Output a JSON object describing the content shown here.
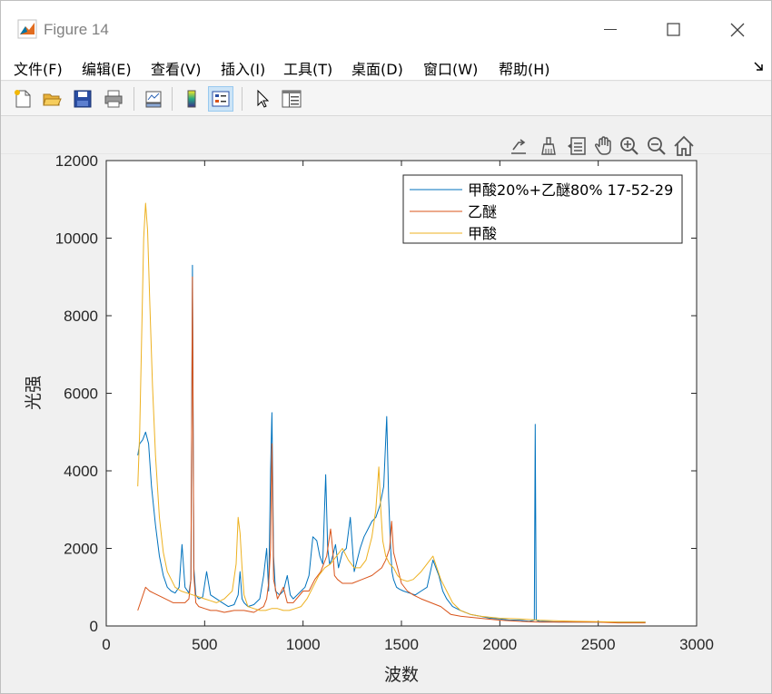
{
  "window": {
    "title": "Figure 14"
  },
  "menu": [
    {
      "label": "文件(F)"
    },
    {
      "label": "编辑(E)"
    },
    {
      "label": "查看(V)"
    },
    {
      "label": "插入(I)"
    },
    {
      "label": "工具(T)"
    },
    {
      "label": "桌面(D)"
    },
    {
      "label": "窗口(W)"
    },
    {
      "label": "帮助(H)"
    }
  ],
  "toolbar": [
    "new-figure",
    "open-file",
    "save",
    "print",
    "link-plot",
    "colorbar",
    "legend",
    "pointer",
    "property-inspector"
  ],
  "axes_toolbar": [
    "export",
    "brush",
    "data-tips",
    "pan",
    "zoom-in",
    "zoom-out",
    "home"
  ],
  "colors": {
    "series1": "#0072BD",
    "series2": "#D95319",
    "series3": "#EDB120"
  },
  "chart_data": {
    "type": "line",
    "xlabel": "波数",
    "ylabel": "光强",
    "xlim": [
      0,
      3000
    ],
    "ylim": [
      0,
      12000
    ],
    "xticks": [
      "0",
      "500",
      "1000",
      "1500",
      "2000",
      "2500",
      "3000"
    ],
    "yticks": [
      "0",
      "2000",
      "4000",
      "6000",
      "8000",
      "10000",
      "12000"
    ],
    "legend_position": "top-right",
    "grid": false,
    "series": [
      {
        "name": "甲酸20%+乙醚80% 17-52-29",
        "color": "#0072BD",
        "x": [
          160,
          170,
          185,
          200,
          215,
          230,
          250,
          270,
          290,
          310,
          330,
          350,
          370,
          385,
          400,
          420,
          430,
          438,
          445,
          455,
          470,
          490,
          510,
          530,
          560,
          590,
          620,
          650,
          670,
          680,
          690,
          700,
          720,
          750,
          780,
          800,
          815,
          825,
          835,
          842,
          850,
          860,
          880,
          900,
          920,
          935,
          950,
          970,
          990,
          1010,
          1030,
          1050,
          1070,
          1085,
          1100,
          1115,
          1125,
          1135,
          1145,
          1155,
          1165,
          1180,
          1200,
          1220,
          1240,
          1260,
          1275,
          1290,
          1310,
          1330,
          1350,
          1370,
          1390,
          1410,
          1425,
          1435,
          1445,
          1452,
          1460,
          1475,
          1490,
          1510,
          1540,
          1570,
          1600,
          1630,
          1660,
          1690,
          1710,
          1730,
          1760,
          1800,
          1850,
          1900,
          1950,
          2000,
          2050,
          2100,
          2150,
          2175,
          2180,
          2185,
          2200,
          2250,
          2300,
          2350,
          2400,
          2450,
          2500,
          2550,
          2600,
          2650,
          2700,
          2740
        ],
        "values": [
          4400,
          4700,
          4800,
          5000,
          4700,
          3600,
          2600,
          1800,
          1300,
          1000,
          900,
          850,
          1000,
          2100,
          1000,
          850,
          1200,
          9300,
          1500,
          800,
          700,
          750,
          1400,
          800,
          700,
          600,
          500,
          550,
          800,
          1400,
          700,
          600,
          500,
          550,
          700,
          1300,
          2000,
          900,
          4000,
          5500,
          1800,
          900,
          800,
          900,
          1300,
          800,
          700,
          800,
          900,
          1000,
          1300,
          2300,
          2200,
          1800,
          1600,
          3900,
          2000,
          1600,
          1700,
          1900,
          2100,
          1500,
          1900,
          2000,
          2800,
          1400,
          1700,
          2000,
          2300,
          2500,
          2700,
          2800,
          3100,
          3600,
          5400,
          3300,
          2000,
          1400,
          1200,
          1000,
          950,
          900,
          850,
          800,
          900,
          1000,
          1700,
          1300,
          900,
          700,
          500,
          400,
          300,
          250,
          200,
          180,
          150,
          150,
          120,
          150,
          5200,
          150,
          120,
          110,
          100,
          100,
          100,
          100,
          100,
          100,
          100,
          100,
          100,
          100
        ]
      },
      {
        "name": "乙醚",
        "color": "#D95319",
        "x": [
          160,
          180,
          200,
          220,
          240,
          260,
          280,
          300,
          320,
          340,
          360,
          380,
          400,
          420,
          430,
          438,
          445,
          455,
          470,
          500,
          530,
          560,
          600,
          650,
          700,
          750,
          800,
          815,
          825,
          835,
          842,
          850,
          870,
          900,
          920,
          950,
          1000,
          1030,
          1060,
          1090,
          1120,
          1140,
          1150,
          1160,
          1175,
          1200,
          1250,
          1300,
          1350,
          1400,
          1420,
          1440,
          1450,
          1460,
          1480,
          1500,
          1530,
          1560,
          1600,
          1650,
          1700,
          1750,
          1800,
          1900,
          2000,
          2100,
          2200,
          2300,
          2400,
          2500,
          2600,
          2700,
          2740
        ],
        "values": [
          400,
          700,
          1000,
          900,
          850,
          800,
          750,
          700,
          650,
          600,
          600,
          600,
          600,
          700,
          1200,
          9000,
          1300,
          600,
          500,
          450,
          400,
          400,
          350,
          400,
          400,
          350,
          500,
          700,
          1100,
          2000,
          4700,
          1200,
          700,
          1000,
          600,
          600,
          900,
          900,
          1200,
          1400,
          1800,
          2500,
          2000,
          1300,
          1200,
          1100,
          1100,
          1200,
          1300,
          1500,
          1700,
          2000,
          2700,
          1900,
          1500,
          1100,
          900,
          800,
          700,
          600,
          500,
          300,
          250,
          200,
          150,
          120,
          100,
          100,
          100,
          100,
          80,
          80,
          80
        ]
      },
      {
        "name": "甲酸",
        "color": "#EDB120",
        "x": [
          160,
          170,
          180,
          190,
          200,
          210,
          220,
          235,
          250,
          270,
          290,
          310,
          330,
          350,
          380,
          410,
          440,
          470,
          500,
          530,
          560,
          600,
          640,
          660,
          670,
          680,
          690,
          700,
          720,
          750,
          780,
          810,
          840,
          870,
          900,
          930,
          960,
          990,
          1020,
          1050,
          1080,
          1110,
          1140,
          1170,
          1200,
          1230,
          1260,
          1290,
          1320,
          1350,
          1370,
          1385,
          1395,
          1405,
          1420,
          1440,
          1460,
          1480,
          1500,
          1530,
          1560,
          1600,
          1630,
          1660,
          1680,
          1700,
          1730,
          1760,
          1800,
          1850,
          1900,
          2000,
          2100,
          2200,
          2300,
          2400,
          2500,
          2600,
          2700,
          2740
        ],
        "values": [
          3600,
          5000,
          7500,
          10000,
          10900,
          10200,
          8500,
          6200,
          4400,
          2800,
          1900,
          1400,
          1200,
          1000,
          900,
          850,
          800,
          750,
          700,
          650,
          600,
          700,
          900,
          1600,
          2800,
          2400,
          1500,
          800,
          500,
          450,
          400,
          400,
          450,
          450,
          400,
          400,
          450,
          500,
          700,
          1000,
          1300,
          1500,
          1600,
          1800,
          2000,
          1700,
          1500,
          1500,
          1700,
          2300,
          3000,
          4100,
          3000,
          2200,
          1800,
          1600,
          1500,
          1300,
          1200,
          1150,
          1200,
          1400,
          1600,
          1800,
          1500,
          1200,
          900,
          600,
          400,
          300,
          250,
          200,
          180,
          150,
          130,
          120,
          110,
          100,
          100,
          100
        ]
      }
    ]
  }
}
